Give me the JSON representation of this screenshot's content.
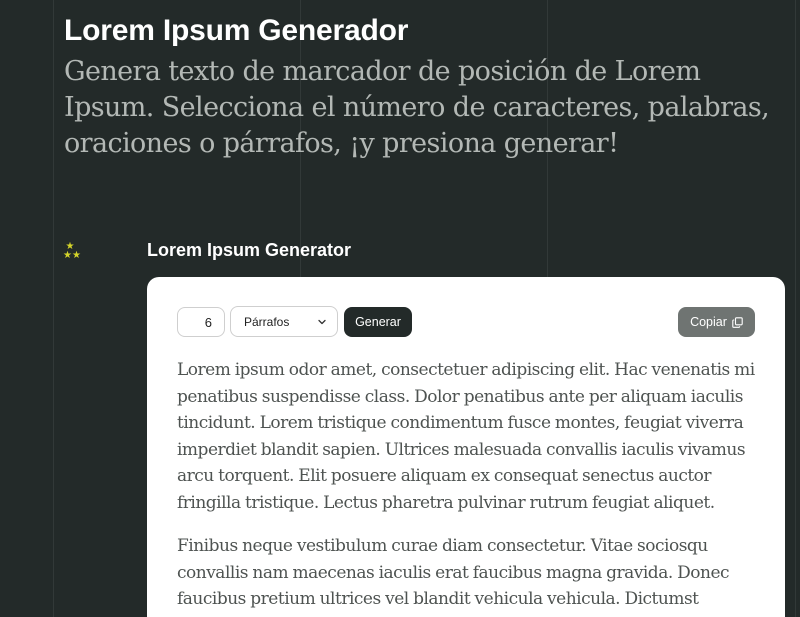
{
  "header": {
    "title": "Lorem Ipsum Generador",
    "subtitle": "Genera texto de marcador de posición de Lorem Ipsum. Selecciona el número de caracteres, palabras, oraciones o párrafos, ¡y presiona generar!"
  },
  "section": {
    "icon": "sparkle-stars-icon",
    "title": "Lorem Ipsum Generator"
  },
  "controls": {
    "count_value": "6",
    "unit_selected": "Párrafos",
    "generate_label": "Generar",
    "copy_label": "Copiar"
  },
  "output": {
    "paragraphs": [
      "Lorem ipsum odor amet, consectetuer adipiscing elit. Hac venenatis mi penatibus suspendisse class. Dolor penatibus ante per aliquam iaculis tincidunt. Lorem tristique condimentum fusce montes, feugiat viverra imperdiet blandit sapien. Ultrices malesuada convallis iaculis vivamus arcu torquent. Elit posuere aliquam ex consequat senectus auctor fringilla tristique. Lectus pharetra pulvinar rutrum feugiat aliquet.",
      "Finibus neque vestibulum curae diam consectetur. Vitae sociosqu convallis nam maecenas iaculis erat faucibus magna gravida. Donec faucibus pretium ultrices vel blandit vehicula vehicula. Dictumst"
    ]
  },
  "colors": {
    "background": "#232a29",
    "card": "#ffffff",
    "accent_star": "#d4d42a",
    "button_dark": "#232a29",
    "button_gray": "#6f7472"
  }
}
